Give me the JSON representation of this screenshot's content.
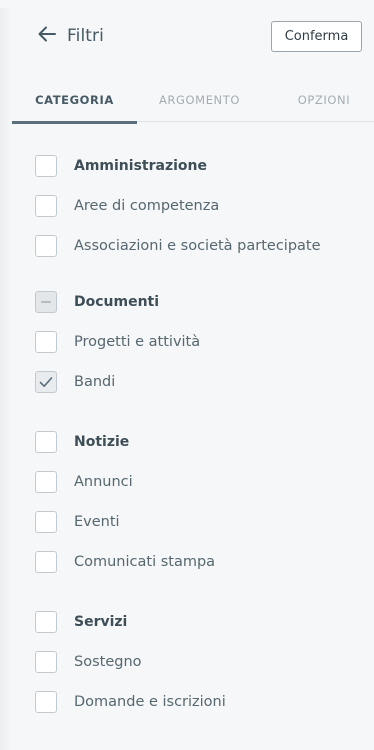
{
  "header": {
    "back_label": "Filtri",
    "confirm_label": "Conferma"
  },
  "tabs": [
    {
      "label": "CATEGORIA",
      "active": true
    },
    {
      "label": "ARGOMENTO",
      "active": false
    },
    {
      "label": "OPZIONI",
      "active": false
    }
  ],
  "groups": [
    {
      "label": "Amministrazione",
      "state": "unchecked",
      "items": [
        {
          "label": "Aree di competenza",
          "state": "unchecked"
        },
        {
          "label": "Associazioni e società partecipate",
          "state": "unchecked"
        }
      ]
    },
    {
      "label": "Documenti",
      "state": "indeterminate",
      "items": [
        {
          "label": "Progetti e attività",
          "state": "unchecked"
        },
        {
          "label": "Bandi",
          "state": "checked"
        }
      ]
    },
    {
      "label": "Notizie",
      "state": "unchecked",
      "items": [
        {
          "label": "Annunci",
          "state": "unchecked"
        },
        {
          "label": "Eventi",
          "state": "unchecked"
        },
        {
          "label": "Comunicati stampa",
          "state": "unchecked"
        }
      ]
    },
    {
      "label": "Servizi",
      "state": "unchecked",
      "items": [
        {
          "label": "Sostegno",
          "state": "unchecked"
        },
        {
          "label": "Domande e iscrizioni",
          "state": "unchecked"
        }
      ]
    }
  ]
}
